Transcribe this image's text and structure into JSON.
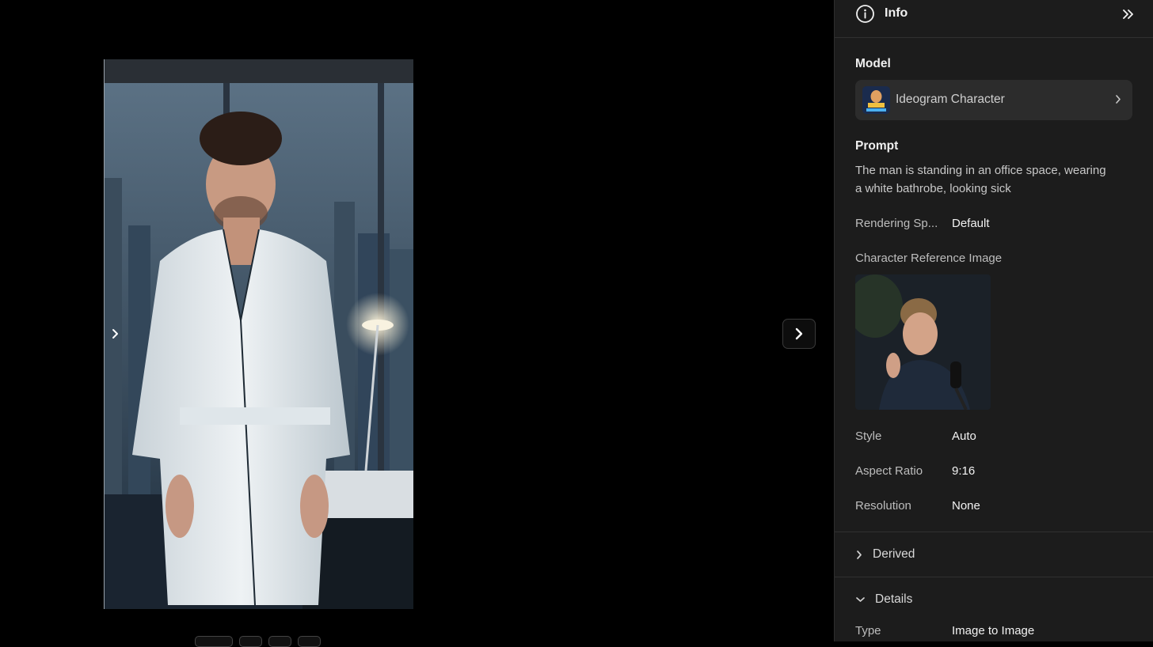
{
  "panel": {
    "title": "Info",
    "model": {
      "label": "Model",
      "name": "Ideogram Character"
    },
    "prompt": {
      "label": "Prompt",
      "text": "The man is standing in an office space, wearing a white bathrobe, looking sick"
    },
    "rendering_speed": {
      "label": "Rendering Sp...",
      "value": "Default"
    },
    "character_reference": {
      "label": "Character Reference Image"
    },
    "style": {
      "label": "Style",
      "value": "Auto"
    },
    "aspect_ratio": {
      "label": "Aspect Ratio",
      "value": "9:16"
    },
    "resolution": {
      "label": "Resolution",
      "value": "None"
    },
    "derived": {
      "label": "Derived"
    },
    "details": {
      "label": "Details",
      "type": {
        "label": "Type",
        "value": "Image to Image"
      }
    }
  },
  "colors": {
    "panel_bg": "#1c1c1c",
    "card_bg": "#2c2c2c",
    "viewer_bg": "#000000"
  },
  "icons": [
    "info-icon",
    "double-chevron-right-icon",
    "chevron-right-icon",
    "chevron-down-icon"
  ]
}
